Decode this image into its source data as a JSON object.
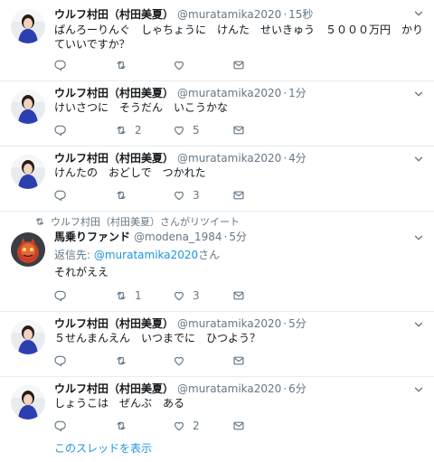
{
  "tweets": [
    {
      "name": "ウルフ村田（村田美夏）",
      "handle": "@muratamika2020",
      "time": "15秒",
      "text": "ぱんろーりんぐ　しゃちょうに　けんた　せいきゅう　５０００万円　かりていいですか？",
      "reply_count": "",
      "retweet_count": "",
      "like_count": ""
    },
    {
      "name": "ウルフ村田（村田美夏）",
      "handle": "@muratamika2020",
      "time": "1分",
      "text": "けいさつに　そうだん　いこうかな",
      "reply_count": "",
      "retweet_count": "2",
      "like_count": "5"
    },
    {
      "name": "ウルフ村田（村田美夏）",
      "handle": "@muratamika2020",
      "time": "4分",
      "text": "けんたの　おどしで　つかれた",
      "reply_count": "",
      "retweet_count": "",
      "like_count": "3"
    },
    {
      "retweeted_by": "ウルフ村田（村田美夏）さんがリツイート",
      "name": "馬乗りファンド",
      "handle": "@modena_1984",
      "time": "5分",
      "reply_prefix": "返信先: ",
      "reply_link": "@muratamika2020",
      "reply_suffix": "さん",
      "text": "それがええ",
      "reply_count": "",
      "retweet_count": "1",
      "like_count": "3"
    },
    {
      "name": "ウルフ村田（村田美夏）",
      "handle": "@muratamika2020",
      "time": "5分",
      "text": "５せんまんえん　いつまでに　ひつよう？",
      "reply_count": "",
      "retweet_count": "",
      "like_count": ""
    },
    {
      "name": "ウルフ村田（村田美夏）",
      "handle": "@muratamika2020",
      "time": "6分",
      "text": "しょうこは　ぜんぶ　ある",
      "reply_count": "",
      "retweet_count": "",
      "like_count": "2"
    }
  ],
  "show_thread": "このスレッドを表示",
  "separator": "·",
  "colors": {
    "link": "#1b95e0",
    "muted": "#657786",
    "border": "#e6ecf0"
  },
  "icons": [
    "reply-icon",
    "retweet-icon",
    "like-icon",
    "dm-icon",
    "chevron-down-icon"
  ]
}
